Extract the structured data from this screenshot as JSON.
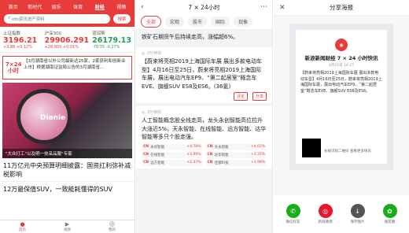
{
  "p1": {
    "nav": [
      "首页",
      "新时代",
      "娱乐",
      "体育",
      "财经",
      "视频"
    ],
    "search_placeholder": "ofo资讯进产资料",
    "search_btn": "搜索",
    "indices": [
      {
        "name": "上证指数",
        "value": "3196.21",
        "delta": "+3.86 +0.12%",
        "tone": "up"
      },
      {
        "name": "沪深300",
        "value": "29906.291",
        "delta": "+28.905 +0.01%",
        "tone": "up"
      },
      {
        "name": "道琼斯",
        "value": "26179.13",
        "delta": "-70.55 -0.27%",
        "tone": "down"
      }
    ],
    "ticker_label": "7×24\n小时",
    "ticker_text": "【3月湖南省以外公司最新达25家，2家获利和创新业上市】根据湖南证监局公告的3月湖南省...",
    "image_caption": "\"大众打工\"以及明一技采品服\"专家",
    "news": [
      "11万亿元中央预算明细披露：国资扛利弥补减税影响",
      "12万最保值SUV，一致能耗懂得的SUV"
    ],
    "tabbar": [
      "首页",
      "视频",
      "我的"
    ]
  },
  "p2": {
    "title": "7 × 24小时",
    "tabs": [
      "全部",
      "宏观",
      "股市",
      "国际",
      "现象"
    ],
    "first": "铁矿石期货午后持续走高，涨幅超6%。",
    "items": [
      {
        "time": "2分钟前",
        "text": "【蔚来将亮相2019上海国际车展 展出多款电动车型】4月16日至25日，蔚来将亮相2019上海国际车展，展出电动汽车EP9、“第二起居室”概念车EVE、旗舰SUV ES8及ES6。(36氪)",
        "actions": [
          "评论",
          "分享"
        ]
      },
      {
        "time": "3分钟前",
        "text": "人工智能概念股全线走高，龙头永创智能高位拉升大涨近5%，天永智能、在线智能、远方智能、达华智能等多只个股走强。"
      }
    ],
    "stocks": [
      {
        "name": "永创智能",
        "pct": "+4.78%"
      },
      {
        "name": "天永智能",
        "pct": "+4.02%"
      },
      {
        "name": "在线智能",
        "pct": "+3.96%"
      },
      {
        "name": "达华智能",
        "pct": "+3.35%"
      },
      {
        "name": "远方智能",
        "pct": "+2.37%"
      },
      {
        "name": "佳都科技",
        "pct": "+1.98%"
      }
    ]
  },
  "p3": {
    "title": "分享海报",
    "card_title": "新浪新闻财经 7 × 24 小时快讯",
    "card_date": "4月16日 14:27",
    "card_text": "【蔚来将亮相2019上海国际车展 展出多款电动车型】4月16日至25日，蔚来将亮相2019上海国际车展，展出电动汽车EP9、“第二起居室”概念车EVE、旗舰SUV ES8及ES6。",
    "qr_text": "长按识别二维码\n查看更多快讯",
    "share": [
      {
        "label": "微信好友",
        "color": "#1aad19"
      },
      {
        "label": "新浪微博",
        "color": "#e6162d"
      },
      {
        "label": "保存图片",
        "color": "#555555"
      },
      {
        "label": "朋友圈",
        "color": "#1aad19"
      }
    ]
  }
}
